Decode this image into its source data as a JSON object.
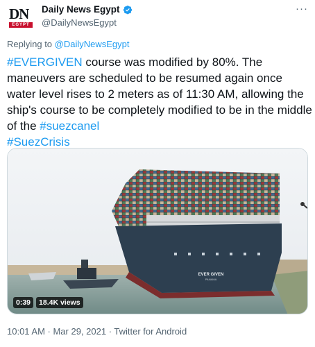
{
  "author": {
    "logo": {
      "line1": "DN",
      "line2": "EGYPT"
    },
    "display_name": "Daily News Egypt",
    "handle": "@DailyNewsEgypt",
    "verified": true
  },
  "menu": {
    "more_label": "···"
  },
  "reply": {
    "prefix": "Replying to ",
    "target": "@DailyNewsEgypt"
  },
  "tweet": {
    "hashtag1": "#EVERGIVEN",
    "text1": " course was modified by 80%. The maneuvers are scheduled to be resumed again once water level rises to 2 meters as of 11:30 AM, allowing the ship's course to be completely modified to be in the middle of the ",
    "hashtag2": "#suezcanel",
    "hashtag3": "#SuezCrisis"
  },
  "video": {
    "duration": "0:39",
    "views": "18.4K views",
    "ship_name": "EVER GIVEN",
    "ship_port": "PANAMA"
  },
  "meta": {
    "time": "10:01 AM · Mar 29, 2021 · Twitter for Android"
  },
  "colors": {
    "accent": "#1d9bf0",
    "secondary_text": "#536471",
    "logo_red": "#c8102e"
  }
}
